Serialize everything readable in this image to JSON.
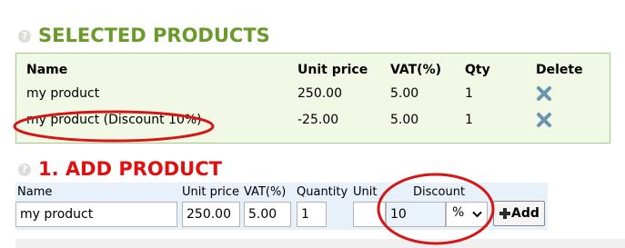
{
  "selected_section": {
    "help_icon": "question-mark-icon",
    "title": "SELECTED PRODUCTS",
    "columns": {
      "name": "Name",
      "unit_price": "Unit price",
      "vat": "VAT(%)",
      "qty": "Qty",
      "delete": "Delete"
    },
    "rows": [
      {
        "name": "my product",
        "unit_price": "250.00",
        "vat": "5.00",
        "qty": "1",
        "delete_icon": "x-delete-icon"
      },
      {
        "name": "my product (Discount 10%)",
        "unit_price": "-25.00",
        "vat": "5.00",
        "qty": "1",
        "delete_icon": "x-delete-icon"
      }
    ]
  },
  "add_section": {
    "help_icon": "question-mark-icon",
    "title": "1. ADD PRODUCT",
    "labels": {
      "name": "Name",
      "unit_price": "Unit price",
      "vat": "VAT(%)",
      "quantity": "Quantity",
      "unit": "Unit",
      "discount": "Discount"
    },
    "values": {
      "name": "my product",
      "unit_price": "250.00",
      "vat": "5.00",
      "quantity": "1",
      "unit": "",
      "discount": "10",
      "discount_type": "%"
    },
    "add_button": "Add",
    "add_icon": "plus-icon"
  },
  "colors": {
    "selected_title": "#6a9a2a",
    "add_title": "#e01010",
    "annotation": "#d81515",
    "delete_icon": "#6a95b0"
  }
}
